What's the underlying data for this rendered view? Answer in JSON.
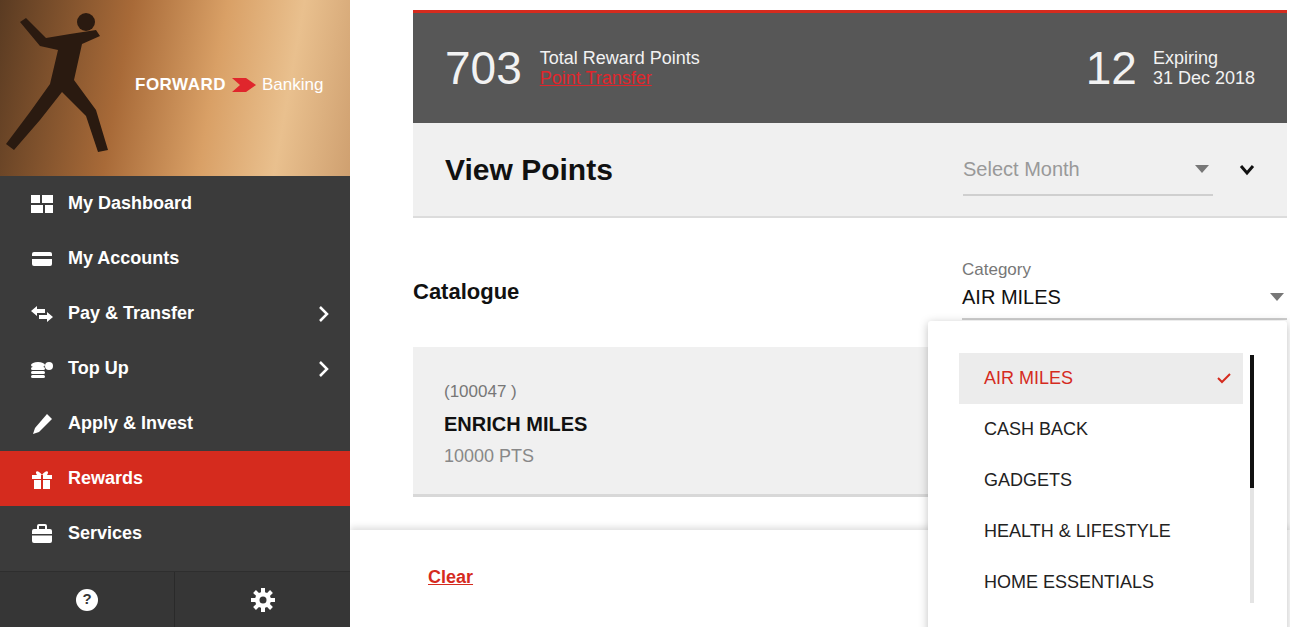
{
  "logo": {
    "brand": "FORWARD",
    "suffix": "Banking"
  },
  "sidebar": {
    "items": [
      {
        "label": "My Dashboard",
        "selected": false,
        "expandable": false
      },
      {
        "label": "My Accounts",
        "selected": false,
        "expandable": false
      },
      {
        "label": "Pay & Transfer",
        "selected": false,
        "expandable": true
      },
      {
        "label": "Top Up",
        "selected": false,
        "expandable": true
      },
      {
        "label": "Apply & Invest",
        "selected": false,
        "expandable": false
      },
      {
        "label": "Rewards",
        "selected": true,
        "expandable": false
      },
      {
        "label": "Services",
        "selected": false,
        "expandable": false
      }
    ],
    "help": "?"
  },
  "points": {
    "total": "703",
    "total_label": "Total Reward Points",
    "transfer_link": "Point Transfer",
    "expiring": "12",
    "expiring_label": "Expiring",
    "expiring_date": "31 Dec 2018"
  },
  "view_points": {
    "title": "View Points",
    "month_placeholder": "Select Month",
    "expanded": false
  },
  "catalogue": {
    "title": "Catalogue",
    "category_label": "Category",
    "category_value": "AIR MILES",
    "items": [
      {
        "code": "(100047 )",
        "name": "ENRICH MILES",
        "points": "10000 PTS"
      }
    ]
  },
  "category_menu": {
    "open": true,
    "options": [
      {
        "label": "AIR MILES",
        "selected": true
      },
      {
        "label": "CASH BACK",
        "selected": false
      },
      {
        "label": "GADGETS",
        "selected": false
      },
      {
        "label": "HEALTH & LIFESTYLE",
        "selected": false
      },
      {
        "label": "HOME ESSENTIALS",
        "selected": false
      }
    ]
  },
  "footer": {
    "clear": "Clear"
  }
}
